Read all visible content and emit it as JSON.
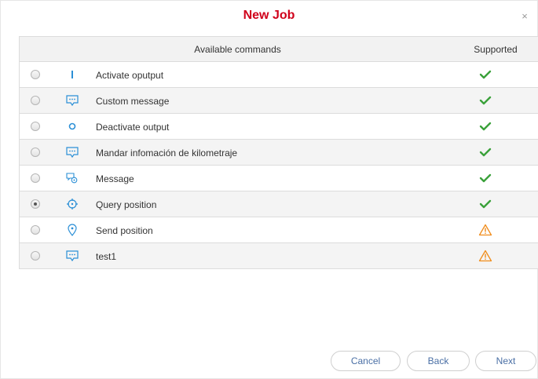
{
  "dialog": {
    "title": "New Job",
    "close_glyph": "×"
  },
  "table": {
    "col_commands": "Available commands",
    "col_supported": "Supported",
    "rows": [
      {
        "label": "Activate oputput",
        "icon": "output-bar-icon",
        "supported": "check",
        "selected": false
      },
      {
        "label": "Custom message",
        "icon": "message-icon",
        "supported": "check",
        "selected": false
      },
      {
        "label": "Deactivate output",
        "icon": "output-circle-icon",
        "supported": "check",
        "selected": false
      },
      {
        "label": "Mandar infomación de kilometraje",
        "icon": "message-icon",
        "supported": "check",
        "selected": false
      },
      {
        "label": "Message",
        "icon": "message-group-icon",
        "supported": "check",
        "selected": false
      },
      {
        "label": "Query position",
        "icon": "crosshair-icon",
        "supported": "check",
        "selected": true
      },
      {
        "label": "Send position",
        "icon": "map-pin-icon",
        "supported": "warning",
        "selected": false
      },
      {
        "label": "test1",
        "icon": "message-icon",
        "supported": "warning",
        "selected": false
      }
    ]
  },
  "buttons": {
    "cancel": "Cancel",
    "back": "Back",
    "next": "Next"
  },
  "colors": {
    "title": "#d0021b",
    "icon_blue": "#2b8fd6",
    "check_green": "#3aa13a",
    "warning_orange": "#f08c1a",
    "button_text": "#4a6fa5"
  }
}
